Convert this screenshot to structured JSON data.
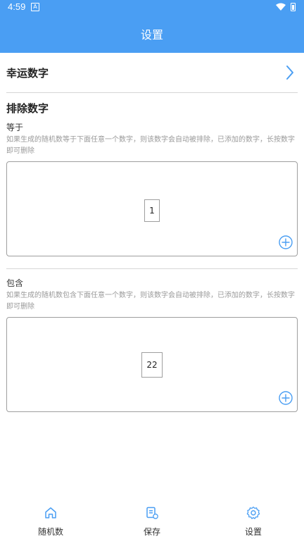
{
  "status": {
    "time": "4:59"
  },
  "header": {
    "title": "设置"
  },
  "lucky": {
    "label": "幸运数字"
  },
  "exclude": {
    "title": "排除数字",
    "equal": {
      "label": "等于",
      "description": "如果生成的随机数等于下面任意一个数字，则该数字会自动被排除，已添加的数字，长按数字即可删除",
      "numbers": [
        "1"
      ]
    },
    "contain": {
      "label": "包含",
      "description": "如果生成的随机数包含下面任意一个数字，则该数字会自动被排除，已添加的数字，长按数字即可删除",
      "numbers": [
        "22"
      ]
    }
  },
  "tabs": [
    {
      "label": "随机数",
      "icon": "home-icon"
    },
    {
      "label": "保存",
      "icon": "save-list-icon"
    },
    {
      "label": "设置",
      "icon": "gear-icon"
    }
  ],
  "colors": {
    "accent": "#4a9ef3",
    "primary_bar": "#4a9ef3"
  }
}
